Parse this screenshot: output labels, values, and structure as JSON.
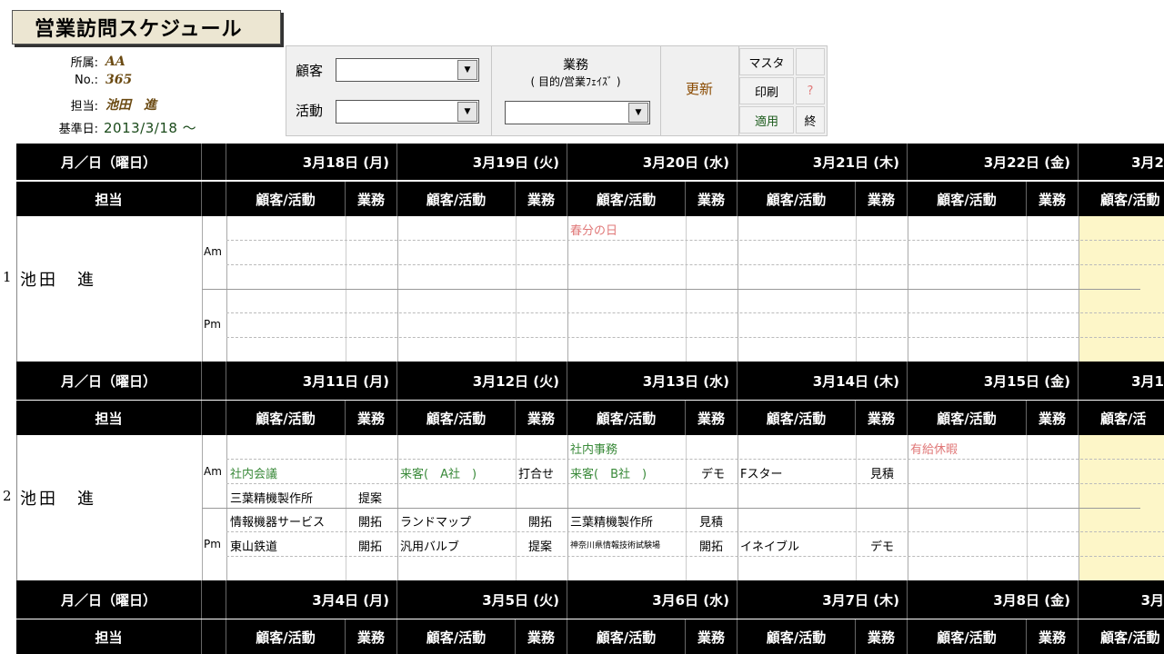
{
  "title": "営業訪問スケジュール",
  "info": {
    "dept_label": "所属:",
    "dept_value": "AA",
    "no_label": "No.:",
    "no_value": "365",
    "owner_label": "担当:",
    "owner_value": "池田　進",
    "base_label": "基準日:",
    "base_value": "2013/3/18 ～"
  },
  "filters": {
    "customer_label": "顧客",
    "activity_label": "活動",
    "gyomu_label": "業務",
    "gyomu_sub": "( 目的/営業ﾌｪｲｽﾞ )",
    "update_label": "更新",
    "master_label": "マスタ",
    "print_label": "印刷",
    "help_label": "?",
    "apply_label": "適用",
    "end_label": "終"
  },
  "colors": {
    "header_bg": "#000000",
    "green_text": "#3a8a3a",
    "pink_text": "#e07878",
    "highlight": "#fdf6c8"
  },
  "weeks": [
    {
      "date_header": "月／日（曜日）",
      "tanto_header": "担当",
      "days": [
        "3月18日 (月)",
        "3月19日 (火)",
        "3月20日 (水)",
        "3月21日 (木)",
        "3月22日 (金)",
        "3月2"
      ],
      "sub": [
        "顧客/活動",
        "業務",
        "顧客/活動",
        "業務",
        "顧客/活動",
        "業務",
        "顧客/活動",
        "業務",
        "顧客/活動",
        "業務",
        "顧客/活動"
      ],
      "row_no": "1",
      "person": "池田　進",
      "am": "Am",
      "pm": "Pm",
      "entries": {
        "holiday": "春分の日"
      }
    },
    {
      "date_header": "月／日（曜日）",
      "tanto_header": "担当",
      "days": [
        "3月11日 (月)",
        "3月12日 (火)",
        "3月13日 (水)",
        "3月14日 (木)",
        "3月15日 (金)",
        "3月1"
      ],
      "sub": [
        "顧客/活動",
        "業務",
        "顧客/活動",
        "業務",
        "顧客/活動",
        "業務",
        "顧客/活動",
        "業務",
        "顧客/活動",
        "業務",
        "顧客/活"
      ],
      "row_no": "2",
      "person": "池田　進",
      "am": "Am",
      "pm": "Pm",
      "entries": {
        "e1": "社内事務",
        "e2": "有給休暇",
        "e3": "社内会議",
        "e4": "来客(　A社　)",
        "e5": "打合せ",
        "e6": "来客(　B社　)",
        "e7": "デモ",
        "e8": "Fスター",
        "e9": "見積",
        "e10": "三葉精機製作所",
        "e11": "提案",
        "e12": "情報機器サービス",
        "e13": "開拓",
        "e14": "ランドマップ",
        "e15": "開拓",
        "e16": "三葉精機製作所",
        "e17": "見積",
        "e18": "東山鉄道",
        "e19": "開拓",
        "e20": "汎用バルブ",
        "e21": "提案",
        "e22": "神奈川県情報技術試験場",
        "e23": "開拓",
        "e24": "イネイブル",
        "e25": "デモ"
      }
    },
    {
      "date_header": "月／日（曜日）",
      "tanto_header": "担当",
      "days": [
        "3月4日 (月)",
        "3月5日 (火)",
        "3月6日 (水)",
        "3月7日 (木)",
        "3月8日 (金)",
        "3月"
      ],
      "sub": [
        "顧客/活動",
        "業務",
        "顧客/活動",
        "業務",
        "顧客/活動",
        "業務",
        "顧客/活動",
        "業務",
        "顧客/活動",
        "業務",
        "顧客/活動"
      ]
    }
  ]
}
